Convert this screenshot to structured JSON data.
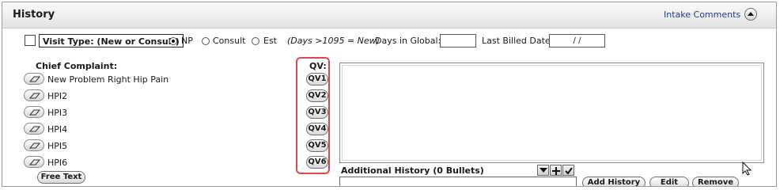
{
  "header": {
    "title": "History",
    "intake_link": "Intake Comments"
  },
  "visit": {
    "type_label": "Visit Type: (New or Consult)",
    "options": [
      {
        "label": "NP",
        "selected": true
      },
      {
        "label": "Consult",
        "selected": false
      },
      {
        "label": "Est",
        "selected": false
      }
    ],
    "days_note": "(Days >1095 = New)",
    "days_in_global_label": "Days in Global:",
    "days_in_global_value": "",
    "last_billed_label": "Last Billed Date:",
    "last_billed_value": "/   /"
  },
  "chief_complaint": {
    "label": "Chief Complaint:",
    "items": [
      "New Problem Right Hip Pain",
      "HPI2",
      "HPI3",
      "HPI4",
      "HPI5",
      "HPI6"
    ],
    "free_text_button": "Free Text"
  },
  "quick_views": {
    "label": "QV:",
    "buttons": [
      "QV1",
      "QV2",
      "QV3",
      "QV4",
      "QV5",
      "QV6"
    ]
  },
  "additional_history": {
    "label": "Additional History (0 Bullets)",
    "input_value": "",
    "buttons": {
      "add": "Add History",
      "edit": "Edit",
      "remove": "Remove"
    }
  },
  "colors": {
    "link": "#1e3a8c",
    "qv_highlight": "#e0474c",
    "header_bg": "#e3e3e3"
  }
}
